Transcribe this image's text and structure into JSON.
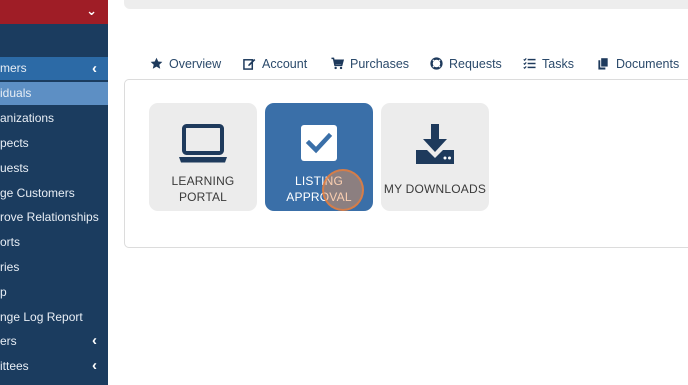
{
  "sidebar": {
    "items": [
      {
        "label": "mers",
        "kind": "group",
        "has_arrow": true
      },
      {
        "label": "iduals",
        "kind": "active"
      },
      {
        "label": "anizations"
      },
      {
        "label": "pects"
      },
      {
        "label": "uests"
      },
      {
        "label": "ge Customers"
      },
      {
        "label": "rove Relationships"
      },
      {
        "label": "orts"
      },
      {
        "label": "ries"
      },
      {
        "label": "p"
      },
      {
        "label": "nge Log Report"
      },
      {
        "label": "ers",
        "has_arrow": true
      },
      {
        "label": "ittees",
        "has_arrow": true
      }
    ],
    "arrow_glyph": "‹",
    "top_chevron": "⌄"
  },
  "tabs": [
    {
      "label": "Overview",
      "icon": "star-icon"
    },
    {
      "label": "Account",
      "icon": "edit-icon"
    },
    {
      "label": "Purchases",
      "icon": "cart-icon"
    },
    {
      "label": "Requests",
      "icon": "lifebuoy-icon"
    },
    {
      "label": "Tasks",
      "icon": "tasks-icon"
    },
    {
      "label": "Documents",
      "icon": "documents-icon"
    }
  ],
  "tiles": [
    {
      "line1": "LEARNING",
      "line2": "PORTAL",
      "icon": "laptop-icon",
      "selected": false
    },
    {
      "line1": "LISTING",
      "line2": "APPROVAL",
      "icon": "checkbox-icon",
      "selected": true
    },
    {
      "line1": "MY DOWNLOADS",
      "line2": "",
      "icon": "download-icon",
      "selected": false
    }
  ],
  "colors": {
    "sidebar_bg": "#1b3c5f",
    "sidebar_top": "#9f1d26",
    "sidebar_group": "#2c6aa6",
    "sidebar_active": "#5d8fc4",
    "tile_selected": "#3a6fa8",
    "tile_default": "#ececec",
    "icon_dark": "#1e3a5c",
    "tab_text": "#2b4a6b"
  }
}
